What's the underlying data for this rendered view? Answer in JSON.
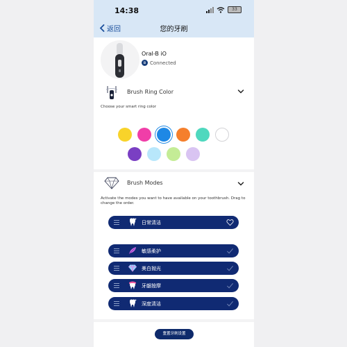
{
  "status": {
    "time": "14:38",
    "battery": "33"
  },
  "nav": {
    "back_label": "返回",
    "title": "您的牙刷"
  },
  "device": {
    "name": "Oral-B iO",
    "status": "Connected"
  },
  "ring_color": {
    "title": "Brush Ring Color",
    "description": "Choose your smart ring color",
    "colors": [
      "#f8d32a",
      "#f03ea8",
      "#1e88e5",
      "#f57f2c",
      "#4fd8be",
      "#ffffff",
      "#7a3fc3",
      "#b8e7fb",
      "#c4ec96",
      "#d9c4f2"
    ],
    "selected_color": "#1e88e5"
  },
  "brush_modes": {
    "title": "Brush Modes",
    "description": "Activate the modes you want to have available on your toothbrush. Drag to change the order.",
    "items": [
      {
        "label": "日常清洁",
        "icon": "tooth-sparkle-icon",
        "state": "heart-outline"
      },
      {
        "label": "敏感柔护",
        "icon": "feather-icon",
        "state": "check"
      },
      {
        "label": "美白抛光",
        "icon": "diamond-icon",
        "state": "check"
      },
      {
        "label": "牙龈按摩",
        "icon": "gum-icon",
        "state": "check"
      },
      {
        "label": "深度清洁",
        "icon": "tooth-sparkle-icon",
        "state": "check"
      }
    ]
  },
  "bottom_button": {
    "label": "重置牙刷设置"
  },
  "colors": {
    "nav_blue": "#1a4f9c",
    "mode_bg": "#102a73",
    "topbar": "#d8e7f6"
  }
}
